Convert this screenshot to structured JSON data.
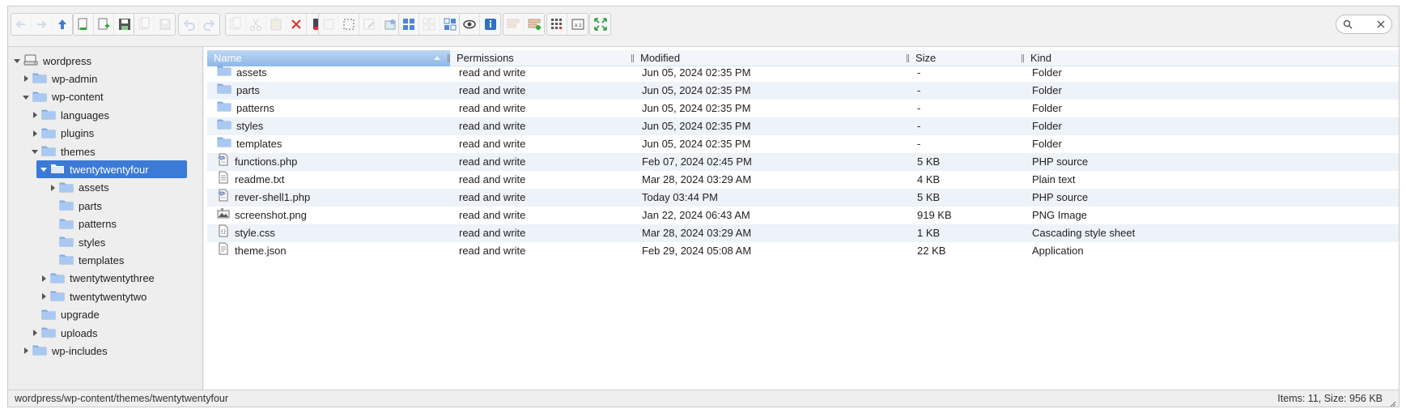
{
  "toolbar": {
    "groups": [
      [
        "back-icon",
        "forward-icon",
        "parent-folder-icon"
      ],
      [
        "open-icon",
        "new-file-icon",
        "save-icon"
      ],
      [
        "copy-doc-icon",
        "disk-icon"
      ],
      [
        "undo-icon",
        "redo-icon"
      ],
      [
        "copy-icon",
        "cut-icon",
        "paste-icon",
        "delete-icon",
        "duplicate-icon"
      ],
      [
        "select-all-icon",
        "select-none-icon",
        "rename-icon",
        "edit-icon"
      ],
      [
        "view-icons-icon",
        "view-list-icon",
        "view-columns-icon"
      ],
      [
        "preview-icon",
        "info-icon"
      ],
      [
        "extract-icon",
        "archive-icon"
      ],
      [
        "sort-icon",
        "resize-icon"
      ],
      [
        "fullscreen-icon"
      ]
    ],
    "search_placeholder": ""
  },
  "tree": [
    {
      "label": "wordpress",
      "depth": 0,
      "arrow": "down",
      "icon": "drive-icon"
    },
    {
      "label": "wp-admin",
      "depth": 1,
      "arrow": "right",
      "icon": "folder-icon"
    },
    {
      "label": "wp-content",
      "depth": 1,
      "arrow": "down",
      "icon": "folder-icon"
    },
    {
      "label": "languages",
      "depth": 2,
      "arrow": "right",
      "icon": "folder-icon"
    },
    {
      "label": "plugins",
      "depth": 2,
      "arrow": "right",
      "icon": "folder-icon"
    },
    {
      "label": "themes",
      "depth": 2,
      "arrow": "down",
      "icon": "folder-icon"
    },
    {
      "label": "twentytwentyfour",
      "depth": 3,
      "arrow": "down",
      "icon": "folder-open-icon",
      "selected": true
    },
    {
      "label": "assets",
      "depth": 4,
      "arrow": "right",
      "icon": "folder-icon"
    },
    {
      "label": "parts",
      "depth": 4,
      "arrow": "none",
      "icon": "folder-icon"
    },
    {
      "label": "patterns",
      "depth": 4,
      "arrow": "none",
      "icon": "folder-icon"
    },
    {
      "label": "styles",
      "depth": 4,
      "arrow": "none",
      "icon": "folder-icon"
    },
    {
      "label": "templates",
      "depth": 4,
      "arrow": "none",
      "icon": "folder-icon"
    },
    {
      "label": "twentytwentythree",
      "depth": 3,
      "arrow": "right",
      "icon": "folder-icon"
    },
    {
      "label": "twentytwentytwo",
      "depth": 3,
      "arrow": "right",
      "icon": "folder-icon"
    },
    {
      "label": "upgrade",
      "depth": 2,
      "arrow": "none",
      "icon": "folder-icon"
    },
    {
      "label": "uploads",
      "depth": 2,
      "arrow": "right",
      "icon": "folder-icon"
    },
    {
      "label": "wp-includes",
      "depth": 1,
      "arrow": "right",
      "icon": "folder-icon"
    }
  ],
  "columns": {
    "name": "Name",
    "permissions": "Permissions",
    "modified": "Modified",
    "size": "Size",
    "kind": "Kind"
  },
  "files": [
    {
      "name": "assets",
      "permissions": "read and write",
      "modified": "Jun 05, 2024 02:35 PM",
      "size": "-",
      "kind": "Folder",
      "icon": "folder-icon"
    },
    {
      "name": "parts",
      "permissions": "read and write",
      "modified": "Jun 05, 2024 02:35 PM",
      "size": "-",
      "kind": "Folder",
      "icon": "folder-icon"
    },
    {
      "name": "patterns",
      "permissions": "read and write",
      "modified": "Jun 05, 2024 02:35 PM",
      "size": "-",
      "kind": "Folder",
      "icon": "folder-icon"
    },
    {
      "name": "styles",
      "permissions": "read and write",
      "modified": "Jun 05, 2024 02:35 PM",
      "size": "-",
      "kind": "Folder",
      "icon": "folder-icon"
    },
    {
      "name": "templates",
      "permissions": "read and write",
      "modified": "Jun 05, 2024 02:35 PM",
      "size": "-",
      "kind": "Folder",
      "icon": "folder-icon"
    },
    {
      "name": "functions.php",
      "permissions": "read and write",
      "modified": "Feb 07, 2024 02:45 PM",
      "size": "5 KB",
      "kind": "PHP source",
      "icon": "php-file-icon"
    },
    {
      "name": "readme.txt",
      "permissions": "read and write",
      "modified": "Mar 28, 2024 03:29 AM",
      "size": "4 KB",
      "kind": "Plain text",
      "icon": "text-file-icon"
    },
    {
      "name": "rever-shell1.php",
      "permissions": "read and write",
      "modified": "Today 03:44 PM",
      "size": "5 KB",
      "kind": "PHP source",
      "icon": "php-file-icon"
    },
    {
      "name": "screenshot.png",
      "permissions": "read and write",
      "modified": "Jan 22, 2024 06:43 AM",
      "size": "919 KB",
      "kind": "PNG Image",
      "icon": "image-file-icon"
    },
    {
      "name": "style.css",
      "permissions": "read and write",
      "modified": "Mar 28, 2024 03:29 AM",
      "size": "1 KB",
      "kind": "Cascading style sheet",
      "icon": "css-file-icon"
    },
    {
      "name": "theme.json",
      "permissions": "read and write",
      "modified": "Feb 29, 2024 05:08 AM",
      "size": "22 KB",
      "kind": "Application",
      "icon": "json-file-icon"
    }
  ],
  "status": {
    "path": "wordpress/wp-content/themes/twentytwentyfour",
    "info": "Items: 11, Size: 956 KB"
  },
  "colors": {
    "selection": "#3b7ad6",
    "folder": "#8fb8ec",
    "row_alt": "#eef2f9"
  }
}
